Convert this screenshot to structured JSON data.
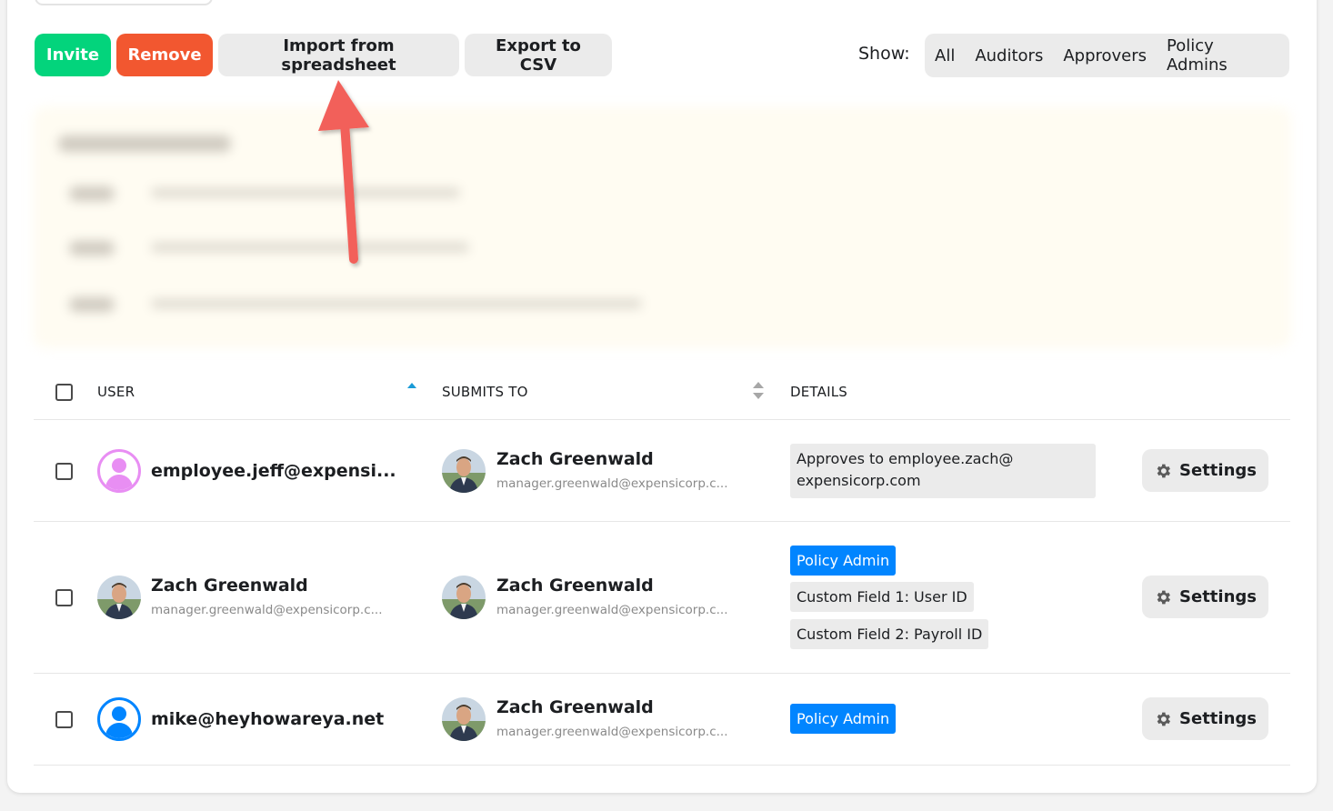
{
  "toolbar": {
    "invite_label": "Invite",
    "remove_label": "Remove",
    "import_label": "Import from spreadsheet",
    "export_label": "Export to CSV"
  },
  "filter": {
    "show_label": "Show:",
    "options": [
      "All",
      "Auditors",
      "Approvers",
      "Policy Admins"
    ]
  },
  "table": {
    "headers": {
      "user": "USER",
      "submits_to": "SUBMITS TO",
      "details": "DETAILS"
    },
    "rows": [
      {
        "user_name": "employee.jeff@expensi...",
        "user_email": "",
        "submits_name": "Zach Greenwald",
        "submits_email": "manager.greenwald@expensicorp.c...",
        "details": [
          "Approves to employee.zach@",
          "expensicorp.com"
        ],
        "settings_label": "Settings"
      },
      {
        "user_name": "Zach Greenwald",
        "user_email": "manager.greenwald@expensicorp.c...",
        "submits_name": "Zach Greenwald",
        "submits_email": "manager.greenwald@expensicorp.c...",
        "badges": [
          "Policy Admin",
          "Custom Field 1: User ID",
          "Custom Field 2: Payroll ID"
        ],
        "settings_label": "Settings"
      },
      {
        "user_name": "mike@heyhowareya.net",
        "user_email": "",
        "submits_name": "Zach Greenwald",
        "submits_email": "manager.greenwald@expensicorp.c...",
        "badges": [
          "Policy Admin"
        ],
        "settings_label": "Settings"
      }
    ]
  },
  "colors": {
    "invite_green": "#03d47c",
    "remove_red": "#f25730",
    "badge_blue": "#0185ff",
    "avatar_pink": "#e88ef3",
    "avatar_blue": "#0185ff",
    "annotation_arrow": "#f2605a"
  }
}
